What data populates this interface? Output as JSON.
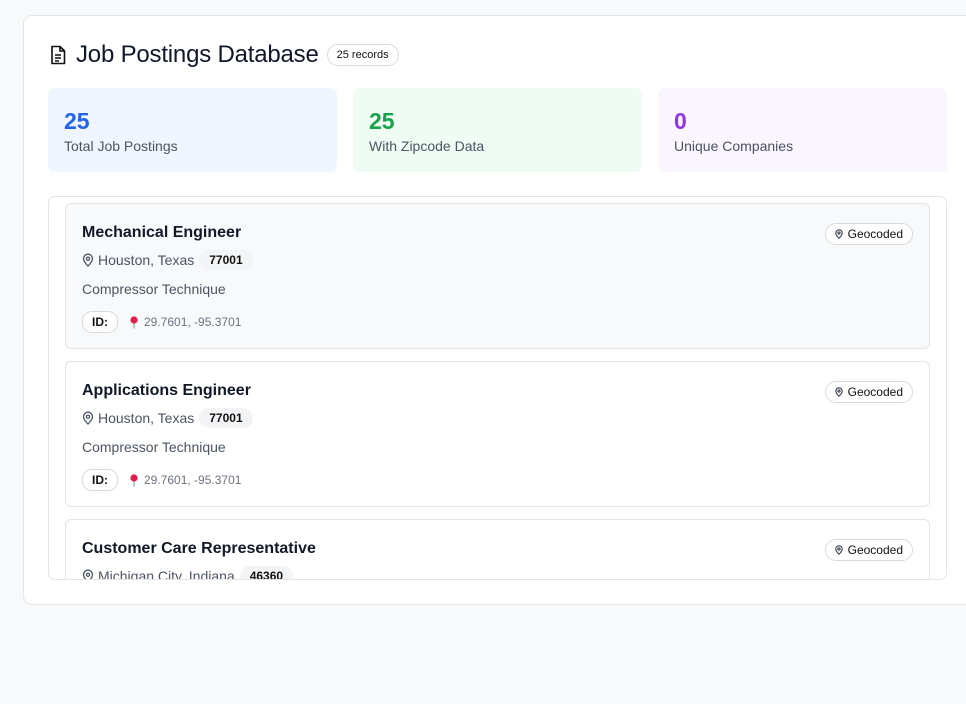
{
  "header": {
    "title": "Job Postings Database",
    "records_badge": "25 records"
  },
  "stats": [
    {
      "value": "25",
      "label": "Total Job Postings",
      "color": "#2563eb"
    },
    {
      "value": "25",
      "label": "With Zipcode Data",
      "color": "#16a34a"
    },
    {
      "value": "0",
      "label": "Unique Companies",
      "color": "#9333ea"
    }
  ],
  "jobs": [
    {
      "title": "Mechanical Engineer",
      "location": "Houston, Texas",
      "zip": "77001",
      "company": "Compressor Technique",
      "id_label": "ID:",
      "coords": "29.7601, -95.3701",
      "status": "Geocoded"
    },
    {
      "title": "Applications Engineer",
      "location": "Houston, Texas",
      "zip": "77001",
      "company": "Compressor Technique",
      "id_label": "ID:",
      "coords": "29.7601, -95.3701",
      "status": "Geocoded"
    },
    {
      "title": "Customer Care Representative",
      "location": "Michigan City, Indiana",
      "zip": "46360",
      "company": "",
      "id_label": "",
      "coords": "",
      "status": "Geocoded"
    }
  ],
  "icons": {
    "header": "document-icon",
    "location": "map-pin-icon",
    "coordinates": "pushpin-icon",
    "geocoded": "location-marker-icon"
  }
}
